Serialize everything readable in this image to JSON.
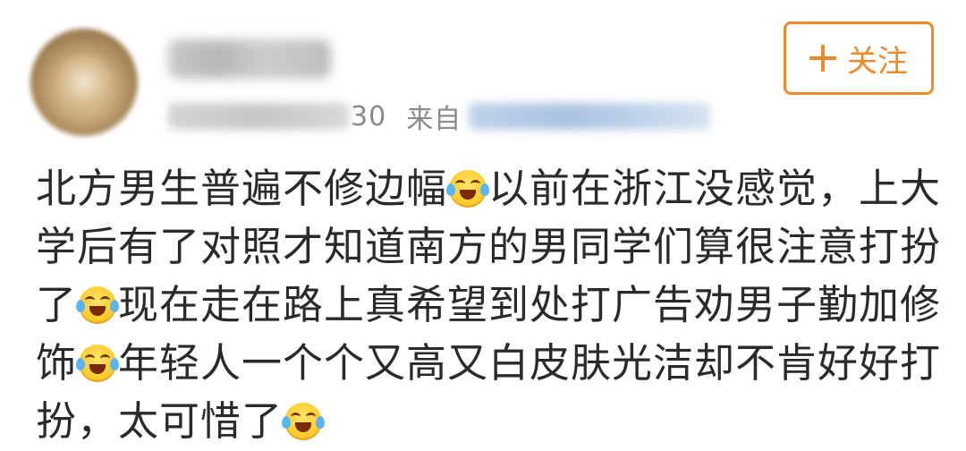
{
  "post_header": {
    "time_visible_suffix": "30",
    "source_prefix": "来自",
    "follow_button_label": "关注"
  },
  "icons": {
    "avatar": "user-avatar (blurred)",
    "follow": "plus-icon",
    "emoji": "laugh-cry-emoji"
  },
  "colors": {
    "accent": "#f18a26",
    "meta_text": "#8a8a8a",
    "body_text": "#2a2a2a"
  },
  "post_body": {
    "line1_a": "北方男生普遍不修边幅",
    "line1_b": "以前在浙江没感觉，上大",
    "line2": "学后有了对照才知道南方的男同学们算很注意打扮",
    "line3_a": "了",
    "line3_b": "现在走在路上真希望到处打广告劝男子勤加修",
    "line4_a": "饰",
    "line4_b": "年轻人一个个又高又白皮肤光洁却不肯好好打",
    "line5": "扮，太可惜了"
  }
}
